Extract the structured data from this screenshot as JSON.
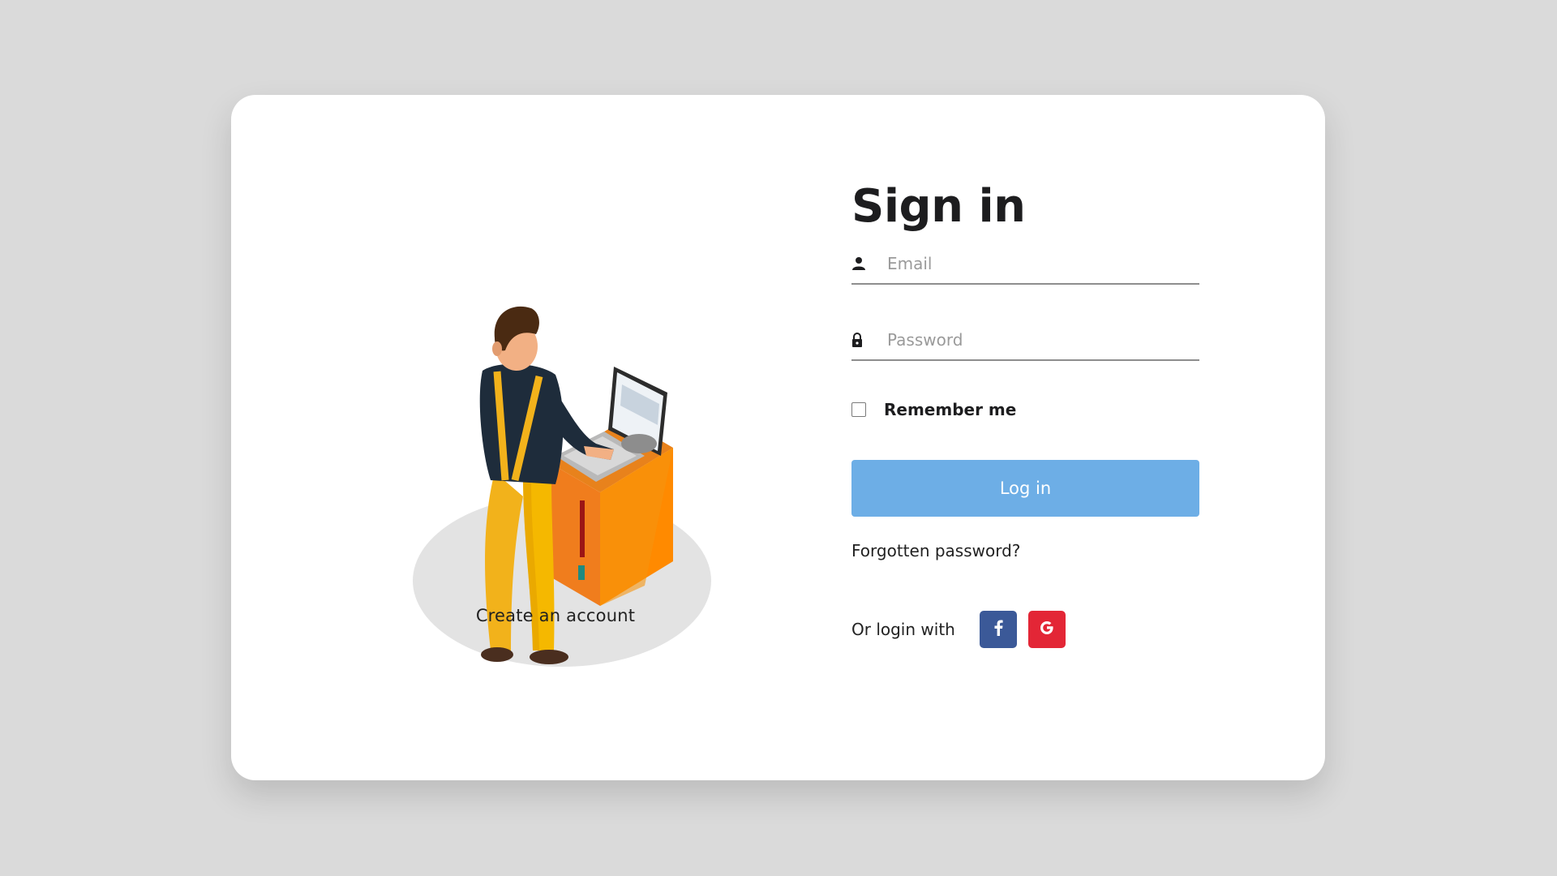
{
  "page": {
    "title": "Sign in",
    "create_account_label": "Create an account"
  },
  "form": {
    "email": {
      "placeholder": "Email",
      "value": "",
      "icon": "user-icon"
    },
    "password": {
      "placeholder": "Password",
      "value": "",
      "icon": "lock-icon"
    },
    "remember": {
      "label": "Remember me",
      "checked": false
    },
    "login_label": "Log in",
    "forgot_label": "Forgotten password?",
    "social": {
      "label": "Or login with",
      "providers": [
        {
          "name": "facebook",
          "icon": "facebook-icon",
          "color": "#3b5998"
        },
        {
          "name": "google",
          "icon": "google-icon",
          "color": "#e32636"
        }
      ]
    }
  },
  "colors": {
    "background": "#dadada",
    "card": "#ffffff",
    "accent": "#6daee6"
  },
  "illustration": {
    "icon": "person-at-computer-terminal-illustration"
  }
}
